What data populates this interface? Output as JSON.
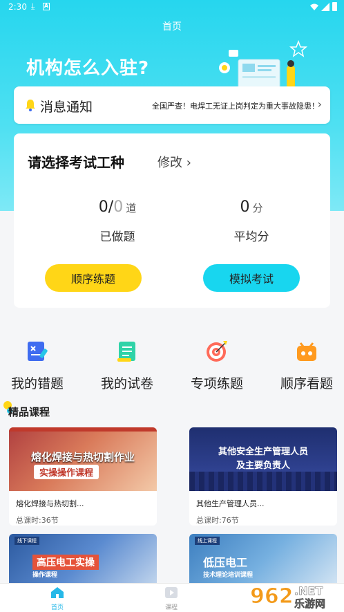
{
  "status": {
    "time": "2:30"
  },
  "nav": {
    "title": "首页"
  },
  "banner": {
    "text": "机构怎么入驻?"
  },
  "notice": {
    "label": "消息通知",
    "message": "全国严查！电焊工无证上岗判定为重大事故隐患！",
    "chevron": "›"
  },
  "exam": {
    "title": "请选择考试工种",
    "modify": "修改",
    "done_count": "0",
    "total_count": "0",
    "done_unit": "道",
    "done_label": "已做题",
    "avg_score": "0",
    "avg_unit": "分",
    "avg_label": "平均分",
    "btn_sequential": "顺序练题",
    "btn_mock": "模拟考试"
  },
  "quick": [
    {
      "label": "我的错题",
      "icon": "wrong-notebook-icon"
    },
    {
      "label": "我的试卷",
      "icon": "exam-paper-icon"
    },
    {
      "label": "专项练题",
      "icon": "target-icon"
    },
    {
      "label": "顺序看题",
      "icon": "game-controller-icon"
    }
  ],
  "section": {
    "title": "精品课程"
  },
  "courses": [
    {
      "name": "熔化焊接与热切割...",
      "hours": "总课时:36节",
      "thumb_title": "熔化焊接与热切割作业",
      "thumb_sub": "实操操作课程"
    },
    {
      "name": "其他生产管理人员...",
      "hours": "总课时:76节",
      "thumb_title": "其他安全生产管理人员",
      "thumb_sub": "及主要负责人"
    },
    {
      "thumb_title": "高压电工实操",
      "thumb_sub": "操作课程",
      "thumb_tag": "线下课程"
    },
    {
      "thumb_title": "低压电工",
      "thumb_sub": "技术理论培训课程",
      "thumb_tag": "线上课程"
    }
  ],
  "tabbar": {
    "home": "首页",
    "course": "课程"
  },
  "watermark": {
    "brand": "962",
    "net": ".NET",
    "site": "乐游网"
  },
  "colors": {
    "primary": "#26d6ee",
    "yellow": "#ffd617",
    "cyan": "#18d6ef"
  }
}
